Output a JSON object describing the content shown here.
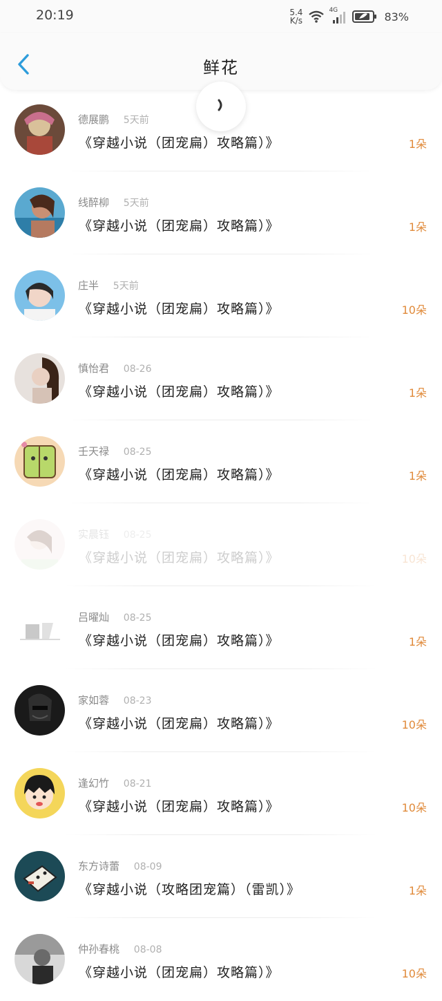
{
  "status": {
    "time": "20:19",
    "speed_value": "5.4",
    "speed_unit": "K/s",
    "network": "4G",
    "battery": "83%"
  },
  "header": {
    "title": "鲜花",
    "back_icon": "chevron-left-icon"
  },
  "colors": {
    "accent": "#2d9cdb",
    "count": "#e08a3a"
  },
  "items": [
    {
      "name": "德展鹏",
      "date": "5天前",
      "book": "《穿越小说（团宠扁）攻略篇）》",
      "count": "1朵"
    },
    {
      "name": "线醉柳",
      "date": "5天前",
      "book": "《穿越小说（团宠扁）攻略篇）》",
      "count": "1朵"
    },
    {
      "name": "庄半",
      "date": "5天前",
      "book": "《穿越小说（团宠扁）攻略篇）》",
      "count": "10朵"
    },
    {
      "name": "慎怡君",
      "date": "08-26",
      "book": "《穿越小说（团宠扁）攻略篇）》",
      "count": "1朵"
    },
    {
      "name": "壬天禄",
      "date": "08-25",
      "book": "《穿越小说（团宠扁）攻略篇）》",
      "count": "1朵"
    },
    {
      "name": "实晨钰",
      "date": "08-25",
      "book": "《穿越小说（团宠扁）攻略篇）》",
      "count": "10朵"
    },
    {
      "name": "吕曜灿",
      "date": "08-25",
      "book": "《穿越小说（团宠扁）攻略篇）》",
      "count": "1朵"
    },
    {
      "name": "家如蓉",
      "date": "08-23",
      "book": "《穿越小说（团宠扁）攻略篇）》",
      "count": "10朵"
    },
    {
      "name": "逢幻竹",
      "date": "08-21",
      "book": "《穿越小说（团宠扁）攻略篇）》",
      "count": "10朵"
    },
    {
      "name": "东方诗蕾",
      "date": "08-09",
      "book": "《穿越小说（攻略团宠篇）（雷凯）》",
      "count": "1朵"
    },
    {
      "name": "仲孙春桃",
      "date": "08-08",
      "book": "《穿越小说（团宠扁）攻略篇）》",
      "count": "10朵"
    }
  ]
}
